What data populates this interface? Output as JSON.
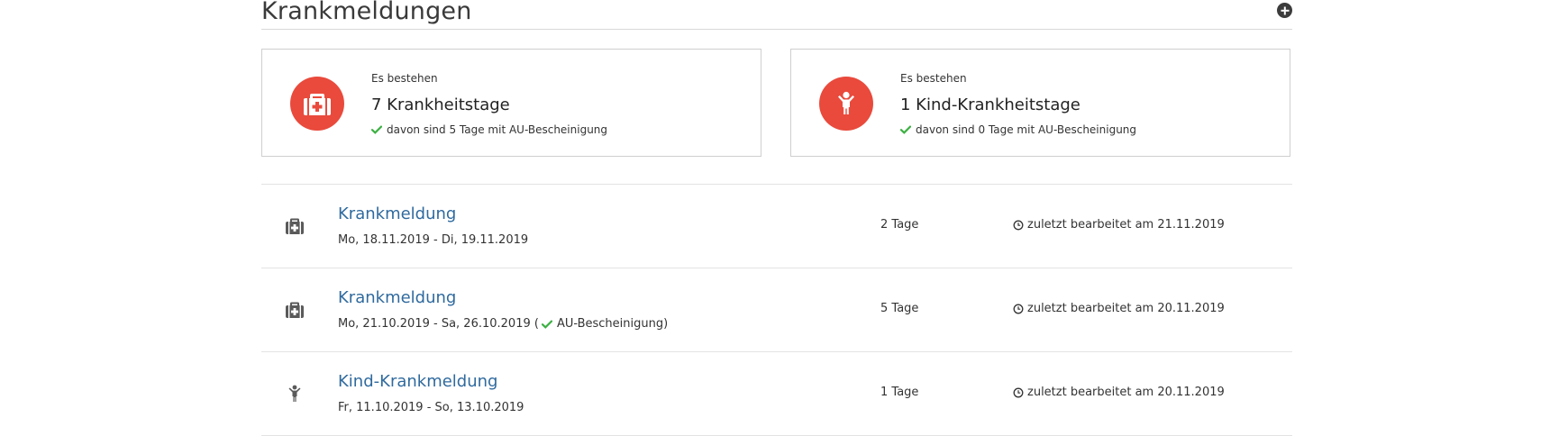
{
  "header": {
    "title": "Krankmeldungen",
    "add_icon": "plus-circle-icon"
  },
  "colors": {
    "accent_red": "#e94a3c",
    "link_blue": "#2f6a9e",
    "check_green": "#3cb043",
    "icon_gray": "#5a5a5a"
  },
  "summary": [
    {
      "icon": "first-aid-kit-icon",
      "pre": "Es bestehen",
      "main": "7 Krankheitstage",
      "sub": "davon sind 5 Tage mit AU-Bescheinigung"
    },
    {
      "icon": "child-icon",
      "pre": "Es bestehen",
      "main": "1 Kind-Krankheitstage",
      "sub": "davon sind 0 Tage mit AU-Bescheinigung"
    }
  ],
  "entries": [
    {
      "icon": "first-aid-kit-icon",
      "title": "Krankmeldung",
      "dates": "Mo, 18.11.2019 - Di, 19.11.2019",
      "days": "2 Tage",
      "edited": "zuletzt bearbeitet am 21.11.2019"
    },
    {
      "icon": "first-aid-kit-icon",
      "title": "Krankmeldung",
      "dates": "Mo, 21.10.2019 - Sa, 26.10.2019 (",
      "au_note": "AU-Bescheinigung)",
      "days": "5 Tage",
      "edited": "zuletzt bearbeitet am 20.11.2019"
    },
    {
      "icon": "child-icon",
      "title": "Kind-Krankmeldung",
      "dates": "Fr, 11.10.2019 - So, 13.10.2019",
      "days": "1 Tage",
      "edited": "zuletzt bearbeitet am 20.11.2019"
    }
  ]
}
